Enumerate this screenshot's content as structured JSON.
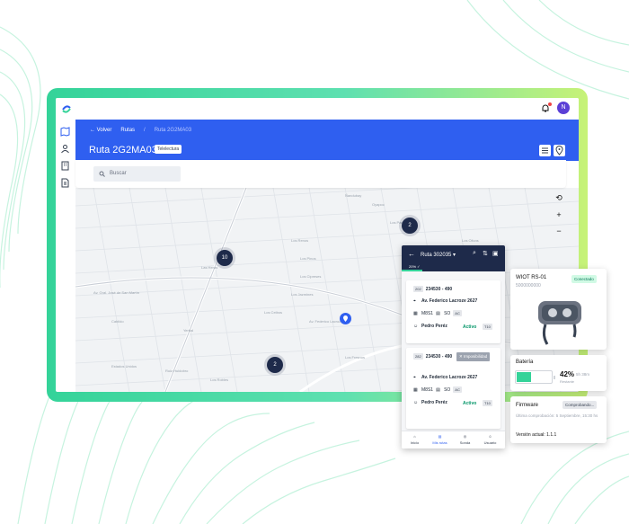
{
  "user": {
    "initial": "N"
  },
  "header": {
    "back_label": "Volver",
    "breadcrumb": [
      "Rutas",
      "Ruta 2G2MA03"
    ],
    "title": "Ruta 2G2MA03",
    "badge": "Telelectura"
  },
  "search": {
    "placeholder": "Buscar"
  },
  "map": {
    "clusters": [
      "2",
      "10",
      "2"
    ],
    "streets": [
      "Ñandubay",
      "Oyapoc",
      "Los Renos",
      "Av. Gral. José de San Martín",
      "Los Pinos",
      "Las Heras",
      "Cabildo",
      "Yerbal",
      "Los Cipreses",
      "Los Ceibos",
      "Estados Unidos",
      "Los Jazmines",
      "Av. Federico Lacroze",
      "Los Paraísos",
      "Ruiz Huidobro",
      "Los Olivos",
      "Los Robles",
      "Los Fresnos"
    ]
  },
  "phone": {
    "title": "Ruta 302035",
    "progress_label": "20% ✓",
    "progress": 0.2,
    "cards": [
      {
        "tag": "202",
        "code": "234530 - 490",
        "address": "Av. Federico Lacroze 2627",
        "meter": "M8S1",
        "tipo": "SO",
        "ac": "AC",
        "person": "Pedro Peréz",
        "status": "Activo",
        "t": "T10"
      },
      {
        "tag": "282",
        "code": "234530 - 490",
        "address": "Av. Federico Lacroze 2627",
        "meter": "M8S1",
        "tipo": "SO",
        "ac": "AC",
        "person": "Pedro Peréz",
        "status": "Activo",
        "t": "T10",
        "flag": "Imposibilidad"
      }
    ],
    "nav": [
      "Inicio",
      "Mis rutas",
      "Sonda",
      "Usuario"
    ]
  },
  "device": {
    "name": "WIOT RS-01",
    "serial": "5000000000",
    "status": "Conectado"
  },
  "battery": {
    "label": "Batería",
    "percent": "42%",
    "time": "5h 38m",
    "remaining": "Restante",
    "level": 0.42
  },
  "firmware": {
    "label": "Firmware",
    "status": "Comprobando...",
    "last_check": "Última comprobación: 5 Septiembre, 15:30 hs",
    "version": "Versión actual: 1.1.1"
  },
  "colors": {
    "accent": "#2f5ff0",
    "dark": "#1e2a4a",
    "green": "#34d399"
  }
}
